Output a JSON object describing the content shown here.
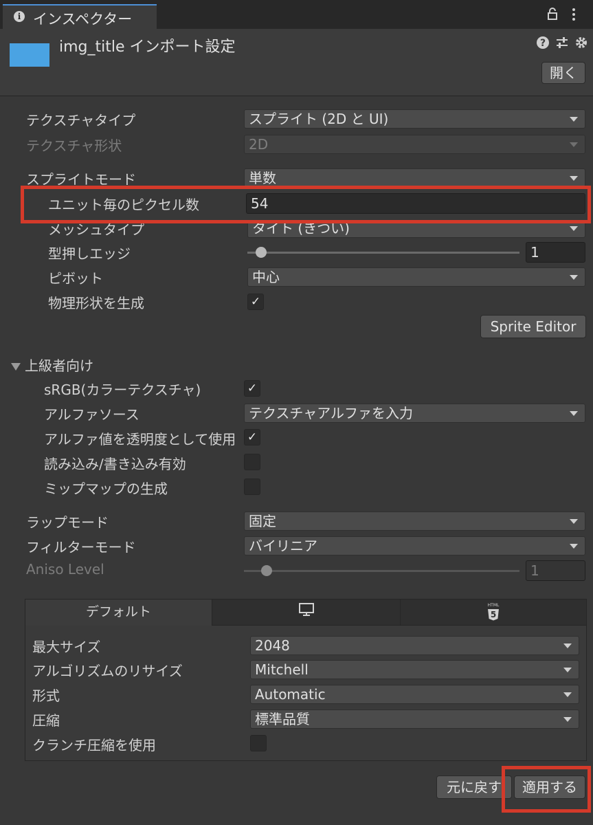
{
  "window": {
    "tab_title": "インスペクター",
    "tab_icon": "info-icon"
  },
  "header": {
    "asset_title": "img_title インポート設定",
    "open_label": "開く",
    "icons": [
      "help-icon",
      "preset-icon",
      "gear-icon",
      "lock-icon",
      "menu-icon"
    ]
  },
  "settings": {
    "texture_type": {
      "label": "テクスチャタイプ",
      "value": "スプライト (2D と UI)"
    },
    "texture_shape": {
      "label": "テクスチャ形状",
      "value": "2D"
    },
    "sprite_mode": {
      "label": "スプライトモード",
      "value": "単数"
    },
    "ppu": {
      "label": "ユニット毎のピクセル数",
      "value": "54"
    },
    "mesh_type": {
      "label": "メッシュタイプ",
      "value": "タイト (きつい)"
    },
    "extrude": {
      "label": "型押しエッジ",
      "value": "1"
    },
    "pivot": {
      "label": "ピボット",
      "value": "中心"
    },
    "physics": {
      "label": "物理形状を生成",
      "checked": true
    },
    "sprite_editor_label": "Sprite Editor"
  },
  "advanced": {
    "header": "上級者向け",
    "srgb": {
      "label": "sRGB(カラーテクスチャ)",
      "checked": true
    },
    "alpha_source": {
      "label": "アルファソース",
      "value": "テクスチャアルファを入力"
    },
    "alpha_transparency": {
      "label": "アルファ値を透明度として使用",
      "checked": true
    },
    "read_write": {
      "label": "読み込み/書き込み有効",
      "checked": false
    },
    "mipmap": {
      "label": "ミップマップの生成",
      "checked": false
    }
  },
  "wrap": {
    "wrap_mode": {
      "label": "ラップモード",
      "value": "固定"
    },
    "filter_mode": {
      "label": "フィルターモード",
      "value": "バイリニア"
    },
    "aniso": {
      "label": "Aniso Level",
      "value": "1"
    }
  },
  "platform": {
    "tabs": [
      {
        "label": "デフォルト"
      },
      {
        "icon": "monitor-icon"
      },
      {
        "icon": "html5-icon",
        "text": "HTML",
        "digit": "5"
      }
    ],
    "max_size": {
      "label": "最大サイズ",
      "value": "2048"
    },
    "resize": {
      "label": "アルゴリズムのリサイズ",
      "value": "Mitchell"
    },
    "format": {
      "label": "形式",
      "value": "Automatic"
    },
    "compression": {
      "label": "圧縮",
      "value": "標準品質"
    },
    "crunch": {
      "label": "クランチ圧縮を使用",
      "checked": false
    }
  },
  "footer": {
    "revert_label": "元に戻す",
    "apply_label": "適用する"
  },
  "colors": {
    "highlight": "#d43a2a",
    "accent": "#4d8fd6",
    "thumb": "#4aa3e3"
  }
}
